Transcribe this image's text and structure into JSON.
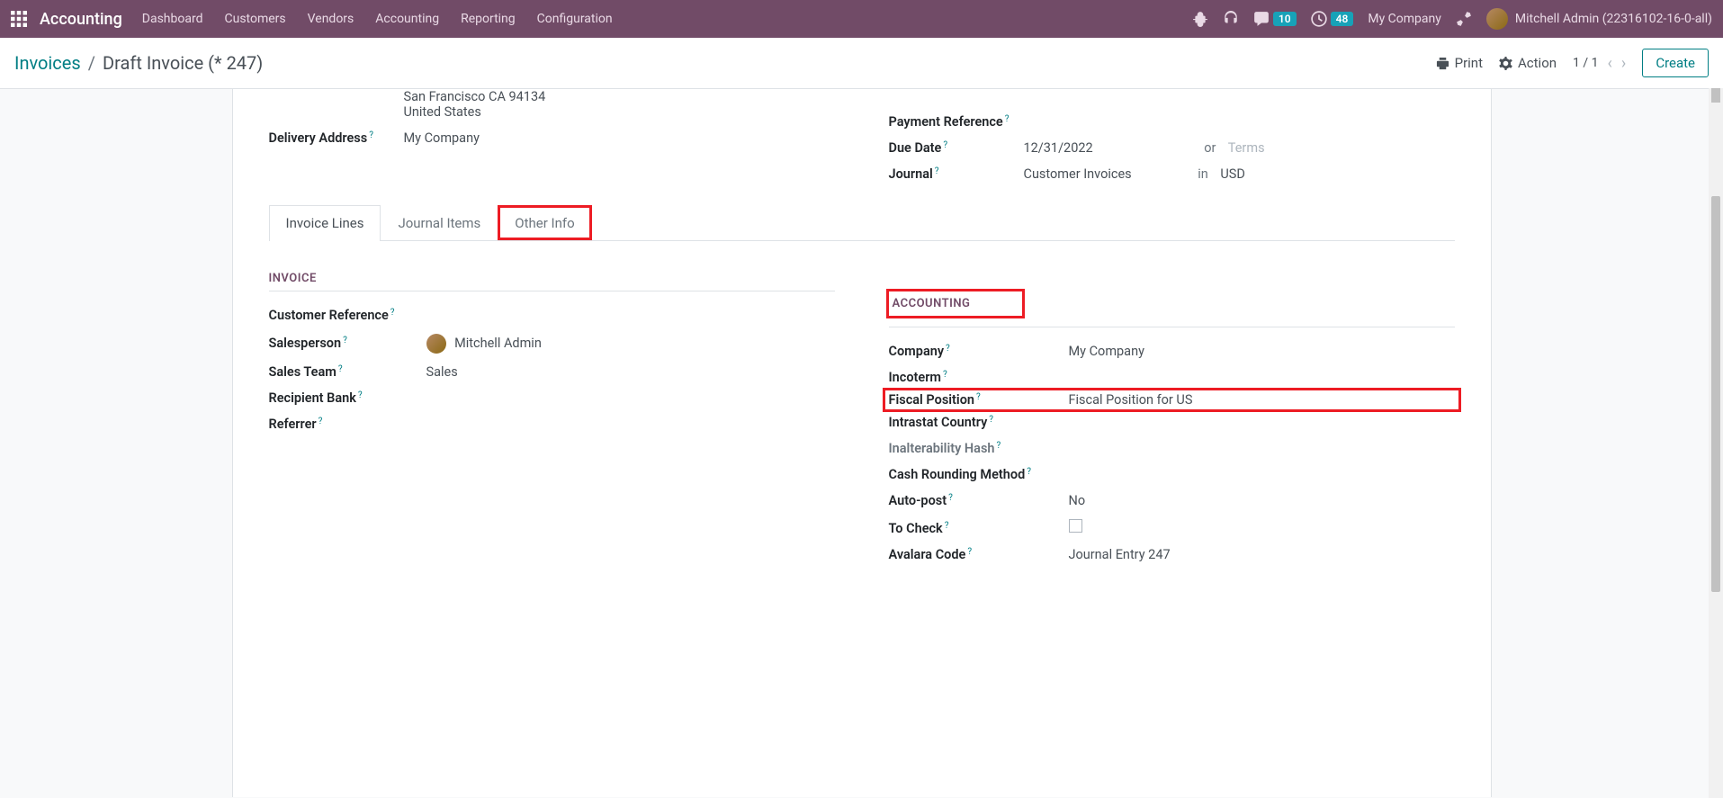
{
  "topbar": {
    "app_name": "Accounting",
    "menu": [
      "Dashboard",
      "Customers",
      "Vendors",
      "Accounting",
      "Reporting",
      "Configuration"
    ],
    "messages_badge": "10",
    "activities_badge": "48",
    "company": "My Company",
    "user": "Mitchell Admin (22316102-16-0-all)"
  },
  "controlbar": {
    "breadcrumb_link": "Invoices",
    "breadcrumb_current": "Draft Invoice (* 247)",
    "print": "Print",
    "action": "Action",
    "pager": "1 / 1",
    "create": "Create"
  },
  "header_fields": {
    "address_line1": "San Francisco CA 94134",
    "address_line2": "United States",
    "delivery_address_label": "Delivery Address",
    "delivery_address_value": "My Company",
    "payment_ref_label": "Payment Reference",
    "due_date_label": "Due Date",
    "due_date_value": "12/31/2022",
    "due_or": "or",
    "due_terms_hint": "Terms",
    "journal_label": "Journal",
    "journal_value": "Customer Invoices",
    "journal_in": "in",
    "journal_currency": "USD"
  },
  "tabs": [
    "Invoice Lines",
    "Journal Items",
    "Other Info"
  ],
  "sections": {
    "invoice_header": "INVOICE",
    "accounting_header": "ACCOUNTING"
  },
  "invoice": {
    "customer_ref_label": "Customer Reference",
    "salesperson_label": "Salesperson",
    "salesperson_value": "Mitchell Admin",
    "sales_team_label": "Sales Team",
    "sales_team_value": "Sales",
    "recipient_bank_label": "Recipient Bank",
    "referrer_label": "Referrer"
  },
  "accounting": {
    "company_label": "Company",
    "company_value": "My Company",
    "incoterm_label": "Incoterm",
    "fiscal_position_label": "Fiscal Position",
    "fiscal_position_value": "Fiscal Position for US",
    "intrastat_label": "Intrastat Country",
    "inalterability_label": "Inalterability Hash",
    "cash_rounding_label": "Cash Rounding Method",
    "auto_post_label": "Auto-post",
    "auto_post_value": "No",
    "to_check_label": "To Check",
    "avalara_code_label": "Avalara Code",
    "avalara_code_value": "Journal Entry 247"
  }
}
